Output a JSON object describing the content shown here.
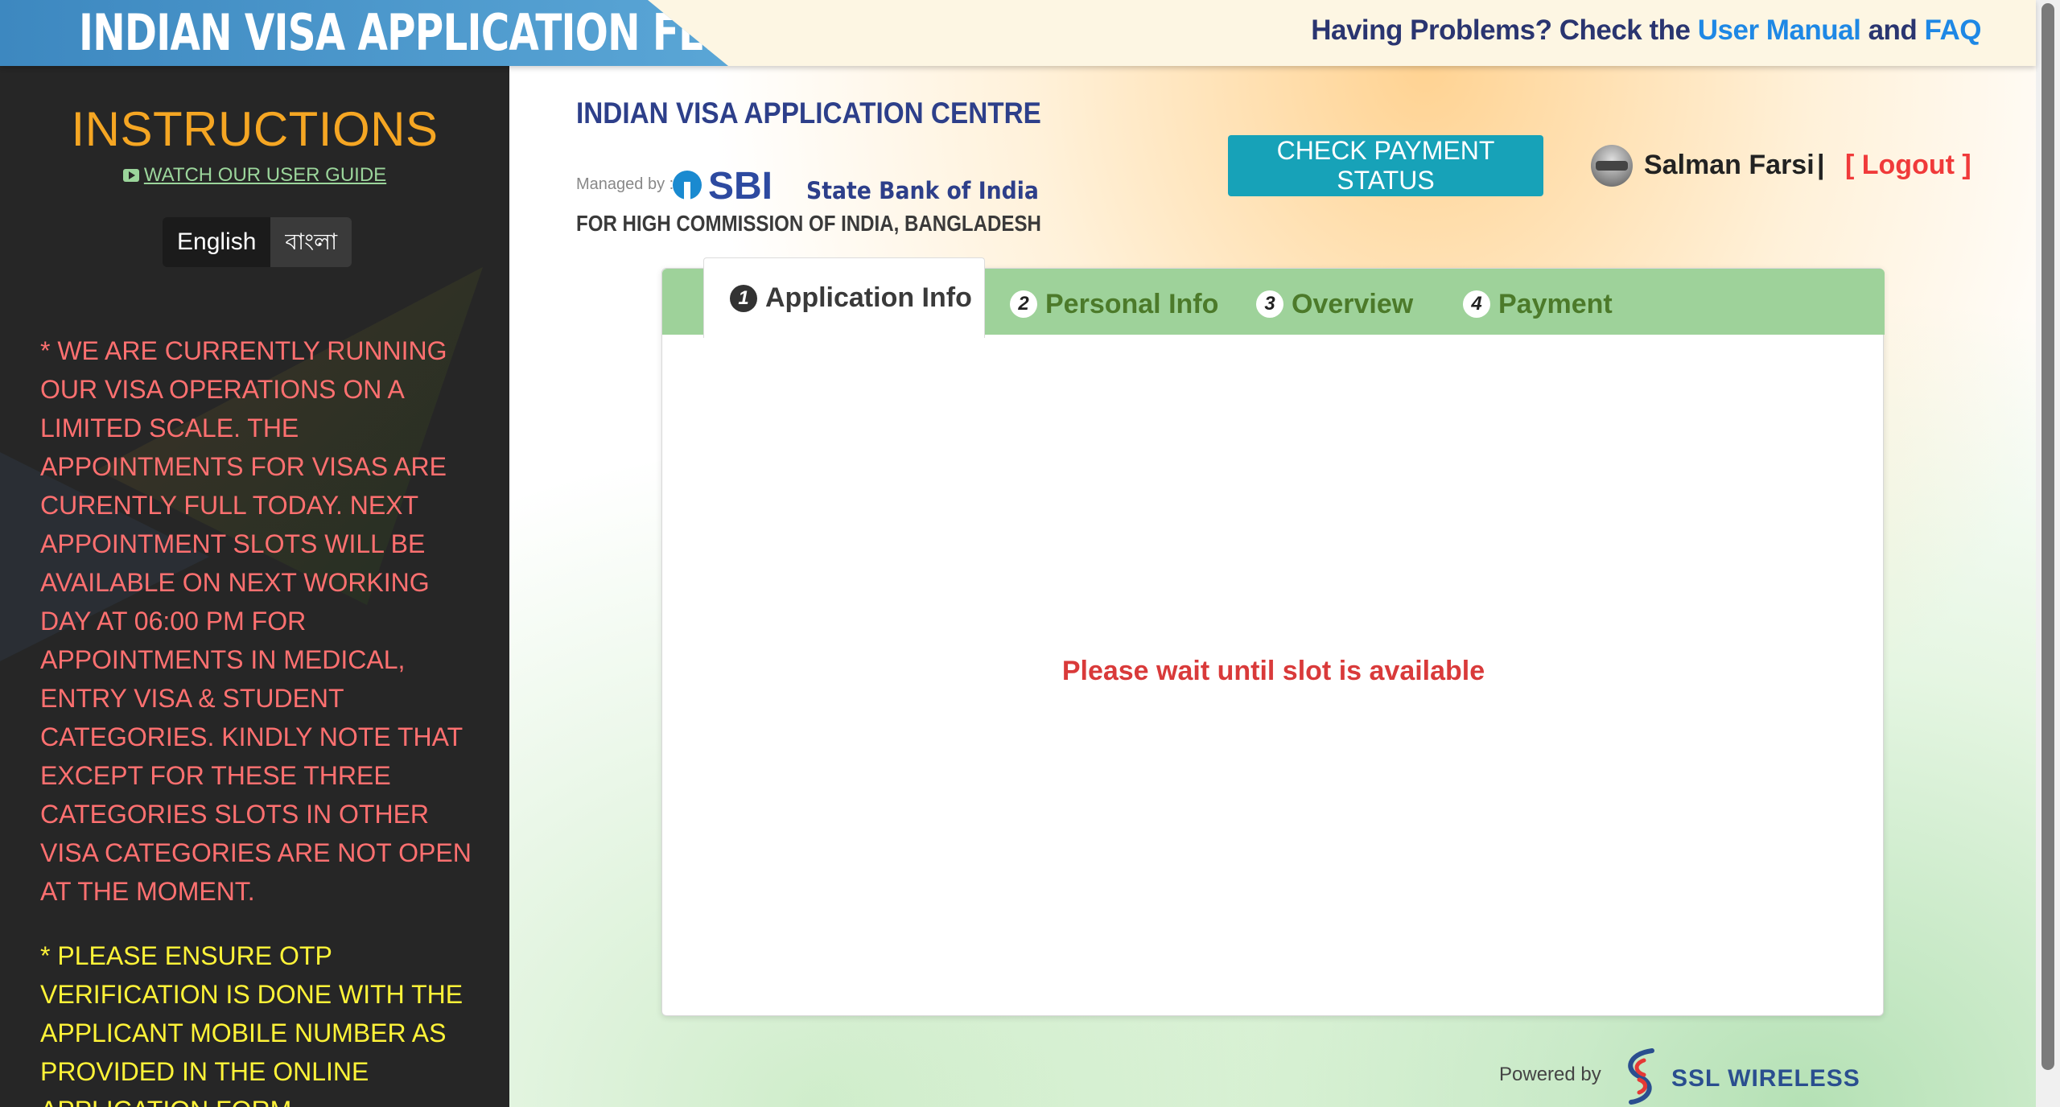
{
  "topbar": {
    "banner_title": "INDIAN VISA APPLICATION FEE",
    "help_prefix": "Having Problems? Check the ",
    "user_manual": "User Manual",
    "and": " and ",
    "faq": "FAQ"
  },
  "sidebar": {
    "title": "INSTRUCTIONS",
    "guide_link": "WATCH OUR USER GUIDE",
    "lang_english": "English",
    "lang_bangla": "বাংলা",
    "notice_red": "* WE ARE CURRENTLY RUNNING OUR VISA OPERATIONS ON A LIMITED SCALE. THE APPOINTMENTS FOR VISAS ARE CURENTLY FULL TODAY. NEXT APPOINTMENT SLOTS WILL BE AVAILABLE ON NEXT WORKING DAY AT 06:00 PM FOR APPOINTMENTS IN MEDICAL, ENTRY VISA & STUDENT CATEGORIES. KINDLY NOTE THAT EXCEPT FOR THESE THREE CATEGORIES SLOTS IN OTHER VISA CATEGORIES ARE NOT OPEN AT THE MOMENT.",
    "notice_yellow": "* PLEASE ENSURE OTP VERIFICATION IS DONE WITH THE APPLICANT MOBILE NUMBER AS PROVIDED IN THE ONLINE APPLICATION FORM"
  },
  "logo": {
    "line1": "INDIAN VISA APPLICATION CENTRE",
    "managed_by": "Managed by :",
    "sbi": "SBI",
    "sbi_full": "State Bank of India",
    "line3": "FOR HIGH COMMISSION OF INDIA, BANGLADESH"
  },
  "header": {
    "check_payment": "CHECK PAYMENT STATUS",
    "username": "Salman Farsi",
    "separator": "|",
    "logout": "[ Logout ]"
  },
  "tabs": [
    {
      "num": "1",
      "label": "Application Info"
    },
    {
      "num": "2",
      "label": "Personal Info"
    },
    {
      "num": "3",
      "label": "Overview"
    },
    {
      "num": "4",
      "label": "Payment"
    }
  ],
  "content": {
    "message": "Please wait until slot is available"
  },
  "footer": {
    "powered_by": "Powered by",
    "company": "SSL WIRELESS"
  },
  "colors": {
    "accent_teal": "#17a2b8",
    "tab_green": "#9ed29a",
    "error_red": "#d93a3a",
    "instruction_orange": "#f5a623"
  }
}
